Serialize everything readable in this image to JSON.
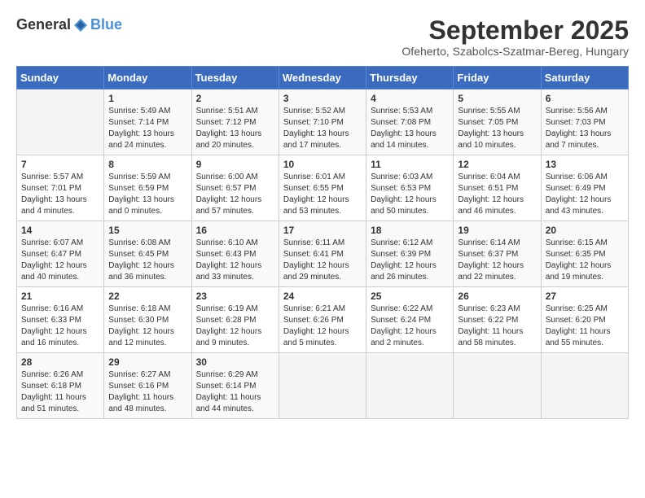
{
  "header": {
    "logo_general": "General",
    "logo_blue": "Blue",
    "month_title": "September 2025",
    "location": "Ofeherto, Szabolcs-Szatmar-Bereg, Hungary"
  },
  "calendar": {
    "weekdays": [
      "Sunday",
      "Monday",
      "Tuesday",
      "Wednesday",
      "Thursday",
      "Friday",
      "Saturday"
    ],
    "weeks": [
      [
        {
          "day": "",
          "info": ""
        },
        {
          "day": "1",
          "info": "Sunrise: 5:49 AM\nSunset: 7:14 PM\nDaylight: 13 hours\nand 24 minutes."
        },
        {
          "day": "2",
          "info": "Sunrise: 5:51 AM\nSunset: 7:12 PM\nDaylight: 13 hours\nand 20 minutes."
        },
        {
          "day": "3",
          "info": "Sunrise: 5:52 AM\nSunset: 7:10 PM\nDaylight: 13 hours\nand 17 minutes."
        },
        {
          "day": "4",
          "info": "Sunrise: 5:53 AM\nSunset: 7:08 PM\nDaylight: 13 hours\nand 14 minutes."
        },
        {
          "day": "5",
          "info": "Sunrise: 5:55 AM\nSunset: 7:05 PM\nDaylight: 13 hours\nand 10 minutes."
        },
        {
          "day": "6",
          "info": "Sunrise: 5:56 AM\nSunset: 7:03 PM\nDaylight: 13 hours\nand 7 minutes."
        }
      ],
      [
        {
          "day": "7",
          "info": "Sunrise: 5:57 AM\nSunset: 7:01 PM\nDaylight: 13 hours\nand 4 minutes."
        },
        {
          "day": "8",
          "info": "Sunrise: 5:59 AM\nSunset: 6:59 PM\nDaylight: 13 hours\nand 0 minutes."
        },
        {
          "day": "9",
          "info": "Sunrise: 6:00 AM\nSunset: 6:57 PM\nDaylight: 12 hours\nand 57 minutes."
        },
        {
          "day": "10",
          "info": "Sunrise: 6:01 AM\nSunset: 6:55 PM\nDaylight: 12 hours\nand 53 minutes."
        },
        {
          "day": "11",
          "info": "Sunrise: 6:03 AM\nSunset: 6:53 PM\nDaylight: 12 hours\nand 50 minutes."
        },
        {
          "day": "12",
          "info": "Sunrise: 6:04 AM\nSunset: 6:51 PM\nDaylight: 12 hours\nand 46 minutes."
        },
        {
          "day": "13",
          "info": "Sunrise: 6:06 AM\nSunset: 6:49 PM\nDaylight: 12 hours\nand 43 minutes."
        }
      ],
      [
        {
          "day": "14",
          "info": "Sunrise: 6:07 AM\nSunset: 6:47 PM\nDaylight: 12 hours\nand 40 minutes."
        },
        {
          "day": "15",
          "info": "Sunrise: 6:08 AM\nSunset: 6:45 PM\nDaylight: 12 hours\nand 36 minutes."
        },
        {
          "day": "16",
          "info": "Sunrise: 6:10 AM\nSunset: 6:43 PM\nDaylight: 12 hours\nand 33 minutes."
        },
        {
          "day": "17",
          "info": "Sunrise: 6:11 AM\nSunset: 6:41 PM\nDaylight: 12 hours\nand 29 minutes."
        },
        {
          "day": "18",
          "info": "Sunrise: 6:12 AM\nSunset: 6:39 PM\nDaylight: 12 hours\nand 26 minutes."
        },
        {
          "day": "19",
          "info": "Sunrise: 6:14 AM\nSunset: 6:37 PM\nDaylight: 12 hours\nand 22 minutes."
        },
        {
          "day": "20",
          "info": "Sunrise: 6:15 AM\nSunset: 6:35 PM\nDaylight: 12 hours\nand 19 minutes."
        }
      ],
      [
        {
          "day": "21",
          "info": "Sunrise: 6:16 AM\nSunset: 6:33 PM\nDaylight: 12 hours\nand 16 minutes."
        },
        {
          "day": "22",
          "info": "Sunrise: 6:18 AM\nSunset: 6:30 PM\nDaylight: 12 hours\nand 12 minutes."
        },
        {
          "day": "23",
          "info": "Sunrise: 6:19 AM\nSunset: 6:28 PM\nDaylight: 12 hours\nand 9 minutes."
        },
        {
          "day": "24",
          "info": "Sunrise: 6:21 AM\nSunset: 6:26 PM\nDaylight: 12 hours\nand 5 minutes."
        },
        {
          "day": "25",
          "info": "Sunrise: 6:22 AM\nSunset: 6:24 PM\nDaylight: 12 hours\nand 2 minutes."
        },
        {
          "day": "26",
          "info": "Sunrise: 6:23 AM\nSunset: 6:22 PM\nDaylight: 11 hours\nand 58 minutes."
        },
        {
          "day": "27",
          "info": "Sunrise: 6:25 AM\nSunset: 6:20 PM\nDaylight: 11 hours\nand 55 minutes."
        }
      ],
      [
        {
          "day": "28",
          "info": "Sunrise: 6:26 AM\nSunset: 6:18 PM\nDaylight: 11 hours\nand 51 minutes."
        },
        {
          "day": "29",
          "info": "Sunrise: 6:27 AM\nSunset: 6:16 PM\nDaylight: 11 hours\nand 48 minutes."
        },
        {
          "day": "30",
          "info": "Sunrise: 6:29 AM\nSunset: 6:14 PM\nDaylight: 11 hours\nand 44 minutes."
        },
        {
          "day": "",
          "info": ""
        },
        {
          "day": "",
          "info": ""
        },
        {
          "day": "",
          "info": ""
        },
        {
          "day": "",
          "info": ""
        }
      ]
    ]
  }
}
